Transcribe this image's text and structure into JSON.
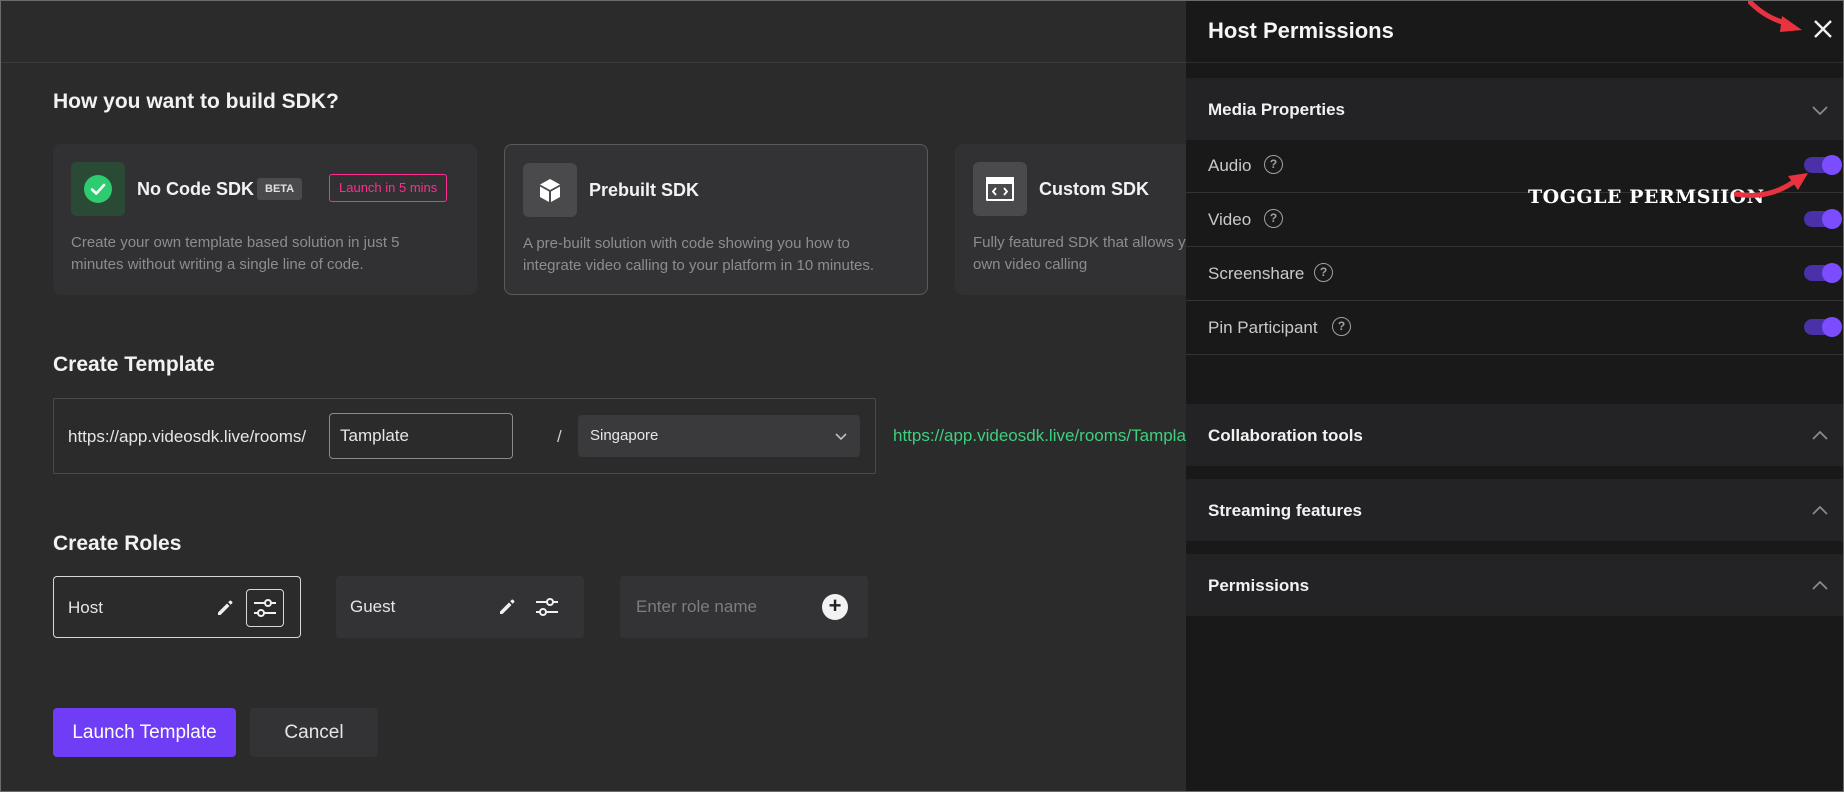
{
  "main": {
    "build_heading": "How you want to build SDK?",
    "cards": [
      {
        "title": "No Code SDK",
        "badge": "BETA",
        "tag": "Launch in 5 mins",
        "desc": "Create your own template based solution in just 5 minutes without writing a single line of code."
      },
      {
        "title": "Prebuilt SDK",
        "desc": "A pre-built solution with code showing you how to integrate video calling to your platform in 10 minutes."
      },
      {
        "title": "Custom SDK",
        "desc": "Fully featured SDK that allows you to customize your own video calling"
      }
    ],
    "template_heading": "Create Template",
    "template": {
      "prefix": "https://app.videosdk.live/rooms/",
      "name_value": "Tamplate",
      "slash": "/",
      "region": "Singapore",
      "url_preview": "https://app.videosdk.live/rooms/Tamplate"
    },
    "roles_heading": "Create Roles",
    "roles": [
      {
        "name": "Host"
      },
      {
        "name": "Guest"
      }
    ],
    "new_role_placeholder": "Enter role name",
    "launch_label": "Launch Template",
    "cancel_label": "Cancel"
  },
  "panel": {
    "title": "Host Permissions",
    "sections": [
      {
        "title": "Media Properties",
        "expanded": true
      },
      {
        "title": "Collaboration tools",
        "expanded": false
      },
      {
        "title": "Streaming features",
        "expanded": false
      },
      {
        "title": "Permissions",
        "expanded": false
      }
    ],
    "permissions": [
      {
        "label": "Audio",
        "enabled": true
      },
      {
        "label": "Video",
        "enabled": true
      },
      {
        "label": "Screenshare",
        "enabled": true
      },
      {
        "label": "Pin Participant",
        "enabled": true
      }
    ]
  },
  "annotation": {
    "text": "TOGGLE PERMSIION",
    "arrow_color": "#e8323f"
  },
  "colors": {
    "accent": "#6e3df5",
    "toggle_on": "#7b4dff",
    "link": "#3ed07f",
    "badge_pink": "#ff2d8e"
  }
}
